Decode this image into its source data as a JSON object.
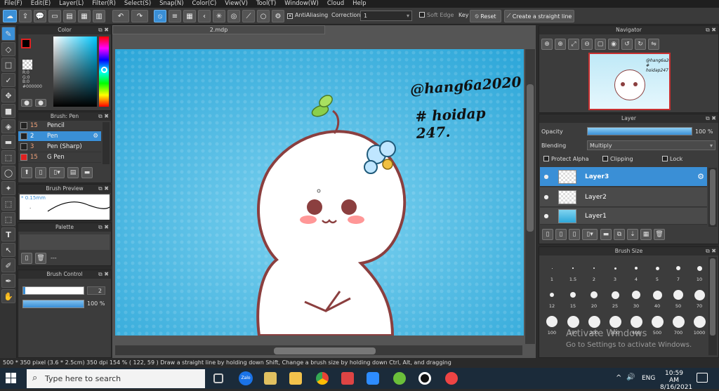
{
  "menu": [
    "File(F)",
    "Edit(E)",
    "Layer(L)",
    "Filter(R)",
    "Select(S)",
    "Snap(N)",
    "Color(C)",
    "View(V)",
    "Tool(T)",
    "Window(W)",
    "Cloud",
    "Help"
  ],
  "toolbar": {
    "antialiasing": "AntiAliasing",
    "correction_label": "Correction",
    "correction_value": "1",
    "soft_edge": "Soft Edge",
    "key_label": "Key",
    "reset": "Reset",
    "straight_line": "Create a straight line"
  },
  "color_panel": {
    "title": "Color",
    "r": "R:0",
    "g": "G:0",
    "b": "B:0",
    "hex": "#000000"
  },
  "brush_panel": {
    "title": "Brush: Pen",
    "items": [
      {
        "size": "15",
        "name": "Pencil",
        "color": "#222222"
      },
      {
        "size": "2",
        "name": "Pen",
        "color": "#222222"
      },
      {
        "size": "3",
        "name": "Pen (Sharp)",
        "color": "#222222"
      },
      {
        "size": "15",
        "name": "G Pen",
        "color": "#e02020"
      }
    ]
  },
  "brush_preview": {
    "title": "Brush Preview",
    "size": "* 0.15mm"
  },
  "palette": {
    "title": "Palette",
    "dashes": "---"
  },
  "brush_control": {
    "title": "Brush Control",
    "size": "2",
    "opacity": "100 %"
  },
  "canvas": {
    "tab": "2.mdp",
    "line1": "@hang6a2020",
    "line2": "# hoidap 247."
  },
  "navigator": {
    "title": "Navigator",
    "thumb_text": "@hang6a2020 # hoidap247"
  },
  "layer_panel": {
    "title": "Layer",
    "opacity_label": "Opacity",
    "opacity_value": "100 %",
    "opacity": 1.0,
    "blending_label": "Blending",
    "blending_value": "Multiply",
    "protect_alpha": "Protect Alpha",
    "clipping": "Clipping",
    "lock": "Lock",
    "layers": [
      "Layer3",
      "Layer2",
      "Layer1"
    ]
  },
  "brush_size": {
    "title": "Brush Size",
    "sizes": [
      "1",
      "1.5",
      "2",
      "3",
      "4",
      "5",
      "7",
      "10",
      "12",
      "15",
      "20",
      "25",
      "30",
      "40",
      "50",
      "70",
      "100",
      "150",
      "200",
      "300",
      "400",
      "500",
      "700",
      "1000"
    ]
  },
  "activate": {
    "line1": "Activate Windows",
    "line2": "Go to Settings to activate Windows."
  },
  "status": "500 * 350 pixel   (3.6 * 2.5cm)   350 dpi   154 %   ( 122, 59 )   Draw a straight line by holding down Shift, Change a brush size by holding down Ctrl, Alt, and dragging",
  "taskbar": {
    "search": "Type here to search",
    "lang": "ENG",
    "time": "10:59 AM",
    "date": "8/16/2021",
    "zalo": "Zalo"
  }
}
